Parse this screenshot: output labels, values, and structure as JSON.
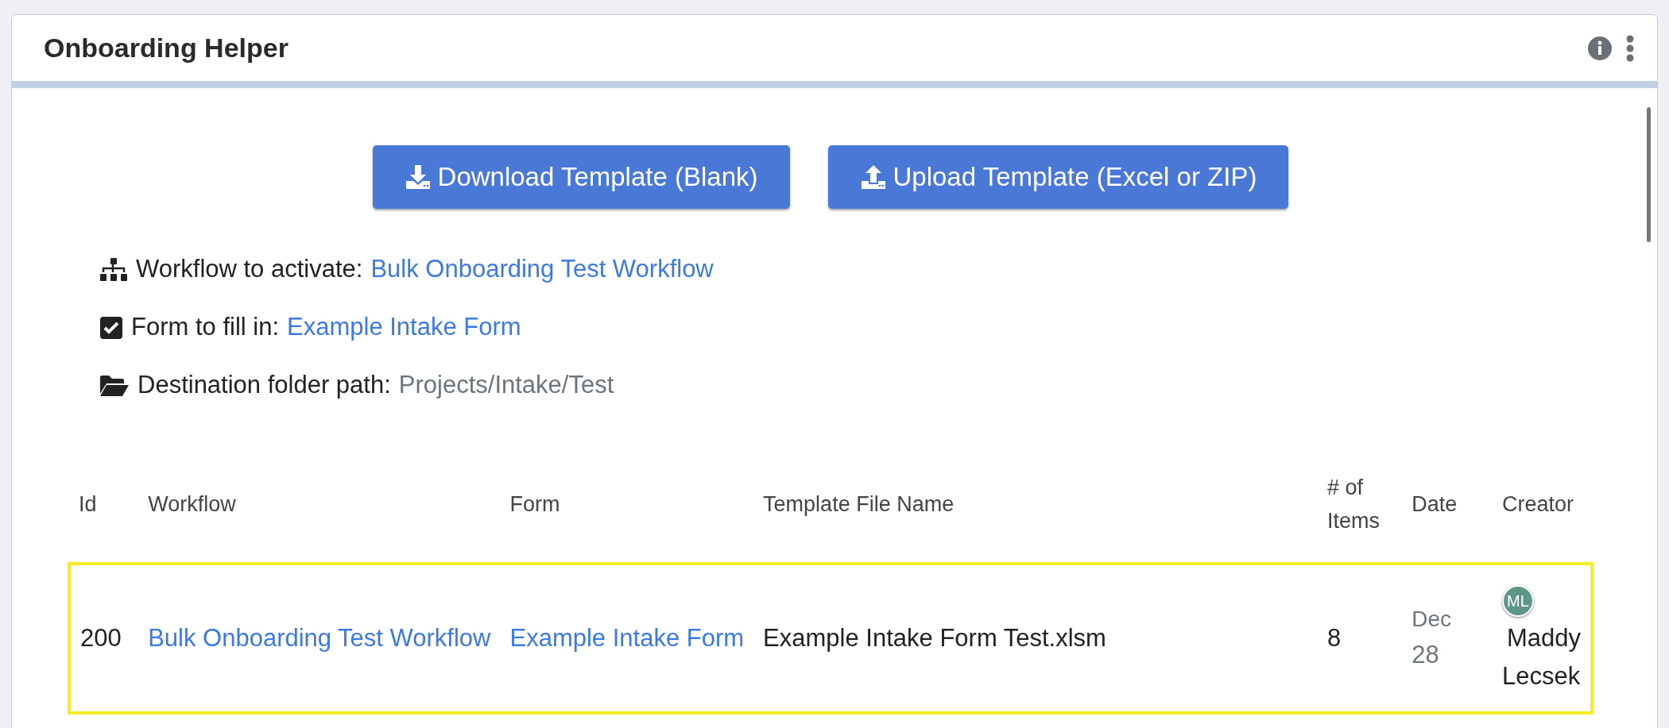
{
  "panel": {
    "title": "Onboarding Helper"
  },
  "actions": [
    {
      "kind": "download",
      "label": "Download Template (Blank)"
    },
    {
      "kind": "upload",
      "label": "Upload Template (Excel or ZIP)"
    }
  ],
  "details": [
    {
      "kind": "workflow",
      "label": "Workflow to activate:",
      "value": "Bulk Onboarding Test Workflow",
      "link": true
    },
    {
      "kind": "form",
      "label": "Form to fill in:",
      "value": "Example Intake Form",
      "link": true
    },
    {
      "kind": "folder",
      "label": "Destination folder path:",
      "value": "Projects/Intake/Test",
      "link": false
    }
  ],
  "table": {
    "columns": [
      "Id",
      "Workflow",
      "Form",
      "Template File Name",
      "# of Items",
      "Date",
      "Creator"
    ],
    "rows": [
      {
        "selected": true,
        "id": "200",
        "workflow": "Bulk Onboarding Test Workflow",
        "form": "Example Intake Form",
        "file": "Example Intake Form Test.xlsm",
        "items": "8",
        "date_month": "Dec",
        "date_day": "28",
        "creator_initials": "ML",
        "creator": "Maddy Lecsek",
        "color": "#5f968a"
      }
    ]
  }
}
